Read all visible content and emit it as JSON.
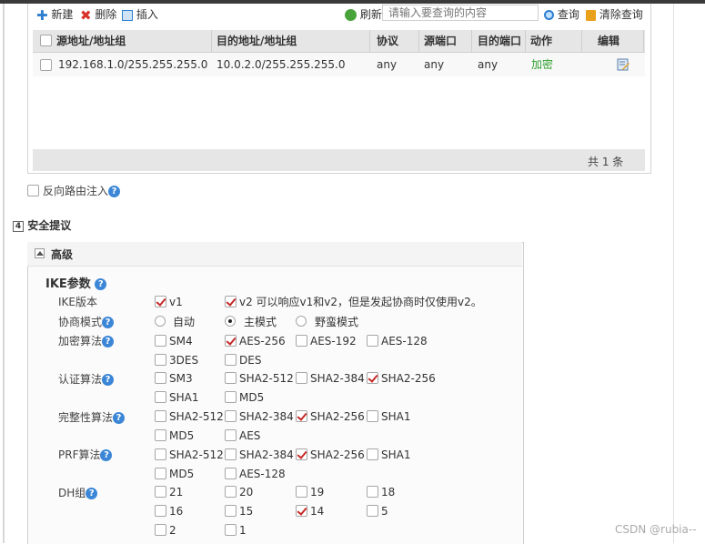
{
  "toolbar": {
    "new_label": "新建",
    "delete_label": "删除",
    "insert_label": "插入",
    "refresh_label": "刷新",
    "search_placeholder": "请输入要查询的内容",
    "query_label": "查询",
    "clear_label": "清除查询"
  },
  "table": {
    "columns": [
      "源地址/地址组",
      "目的地址/地址组",
      "协议",
      "源端口",
      "目的端口",
      "动作",
      "编辑"
    ],
    "rows": [
      {
        "src": "192.168.1.0/255.255.255.0",
        "dst": "10.0.2.0/255.255.255.0",
        "protocol": "any",
        "src_port": "any",
        "dst_port": "any",
        "action": "加密"
      }
    ],
    "footer": "共 1 条"
  },
  "reverse_route_label": "反向路由注入",
  "section": {
    "number": "4",
    "title": "安全提议"
  },
  "advanced": {
    "title": "高级",
    "ike_title": "IKE参数",
    "ike_version": {
      "label": "IKE版本",
      "v1": "v1",
      "v2": "v2  可以响应v1和v2，但是发起协商时仅使用v2。"
    },
    "negotiation": {
      "label": "协商模式",
      "options": [
        "自动",
        "主模式",
        "野蛮模式"
      ],
      "selected": "主模式"
    },
    "encryption": {
      "label": "加密算法",
      "options": [
        "SM4",
        "AES-256",
        "AES-192",
        "AES-128",
        "3DES",
        "DES"
      ],
      "checked": [
        "AES-256"
      ]
    },
    "auth": {
      "label": "认证算法",
      "options": [
        "SM3",
        "SHA2-512",
        "SHA2-384",
        "SHA2-256",
        "SHA1",
        "MD5"
      ],
      "checked": [
        "SHA2-256"
      ]
    },
    "integrity": {
      "label": "完整性算法",
      "options": [
        "SHA2-512",
        "SHA2-384",
        "SHA2-256",
        "SHA1",
        "MD5",
        "AES"
      ],
      "checked": [
        "SHA2-256"
      ]
    },
    "prf": {
      "label": "PRF算法",
      "options": [
        "SHA2-512",
        "SHA2-384",
        "SHA2-256",
        "SHA1",
        "MD5",
        "AES-128"
      ],
      "checked": [
        "SHA2-256"
      ]
    },
    "dh": {
      "label": "DH组",
      "options": [
        "21",
        "20",
        "19",
        "18",
        "16",
        "15",
        "14",
        "5",
        "2",
        "1"
      ],
      "checked": [
        "14"
      ]
    }
  },
  "watermark": "CSDN @rubia--",
  "colors": {
    "accent": "#2f7fd0",
    "check": "#c62828",
    "action_green": "#2fa12f"
  }
}
